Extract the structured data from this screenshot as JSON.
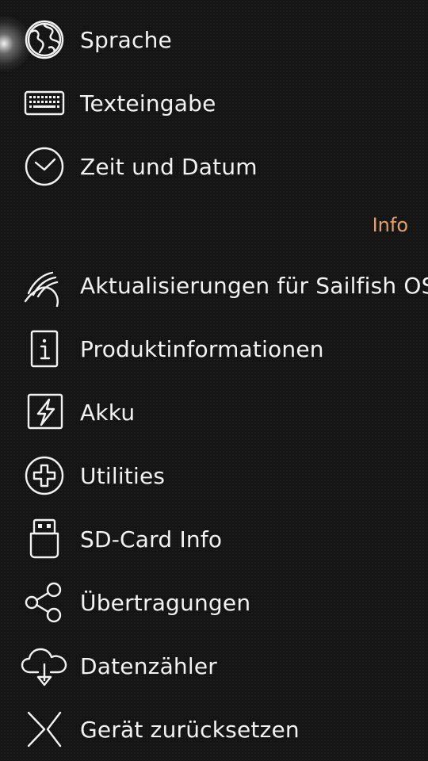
{
  "settings": {
    "top_items": [
      {
        "label": "Sprache",
        "icon": "globe-icon"
      },
      {
        "label": "Texteingabe",
        "icon": "keyboard-icon"
      },
      {
        "label": "Zeit und Datum",
        "icon": "clock-icon"
      }
    ],
    "info_section": {
      "header": "Info",
      "header_color": "#e0a067"
    },
    "info_items": [
      {
        "label": "Aktualisierungen für Sailfish OS",
        "icon": "sailfish-update-icon"
      },
      {
        "label": "Produktinformationen",
        "icon": "info-icon"
      },
      {
        "label": "Akku",
        "icon": "battery-bolt-icon"
      },
      {
        "label": "Utilities",
        "icon": "utilities-plus-icon"
      },
      {
        "label": "SD-Card Info",
        "icon": "sd-card-icon"
      },
      {
        "label": "Übertragungen",
        "icon": "share-icon"
      },
      {
        "label": "Datenzähler",
        "icon": "cloud-download-icon"
      },
      {
        "label": "Gerät zurücksetzen",
        "icon": "reset-icon"
      }
    ]
  }
}
